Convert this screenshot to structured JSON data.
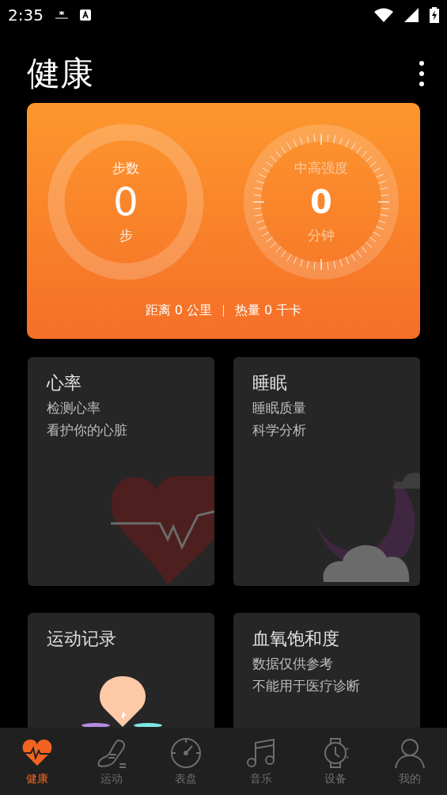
{
  "status_bar": {
    "time": "2:35"
  },
  "title": "健康",
  "summary": {
    "steps": {
      "label": "步数",
      "value": "0",
      "unit": "步"
    },
    "intensity": {
      "label": "中高强度",
      "value": "0",
      "unit": "分钟"
    },
    "distance": "距离 0 公里",
    "calories": "热量 0 千卡"
  },
  "cards": [
    {
      "kind": "heart",
      "title": "心率",
      "lines": [
        "检测心率",
        "看护你的心脏"
      ]
    },
    {
      "kind": "sleep",
      "title": "睡眠",
      "lines": [
        "睡眠质量",
        "科学分析"
      ]
    },
    {
      "kind": "workout",
      "title": "运动记录"
    },
    {
      "kind": "oxygen",
      "title": "血氧饱和度",
      "lines": [
        "数据仅供参考",
        "不能用于医疗诊断"
      ]
    }
  ],
  "tabs": [
    {
      "kind": "health",
      "label": "健康",
      "selected": true
    },
    {
      "kind": "sport",
      "label": "运动",
      "selected": false
    },
    {
      "kind": "dial",
      "label": "表盘",
      "selected": false
    },
    {
      "kind": "music",
      "label": "音乐",
      "selected": false
    },
    {
      "kind": "device",
      "label": "设备",
      "selected": false
    },
    {
      "kind": "me",
      "label": "我的",
      "selected": false
    }
  ]
}
